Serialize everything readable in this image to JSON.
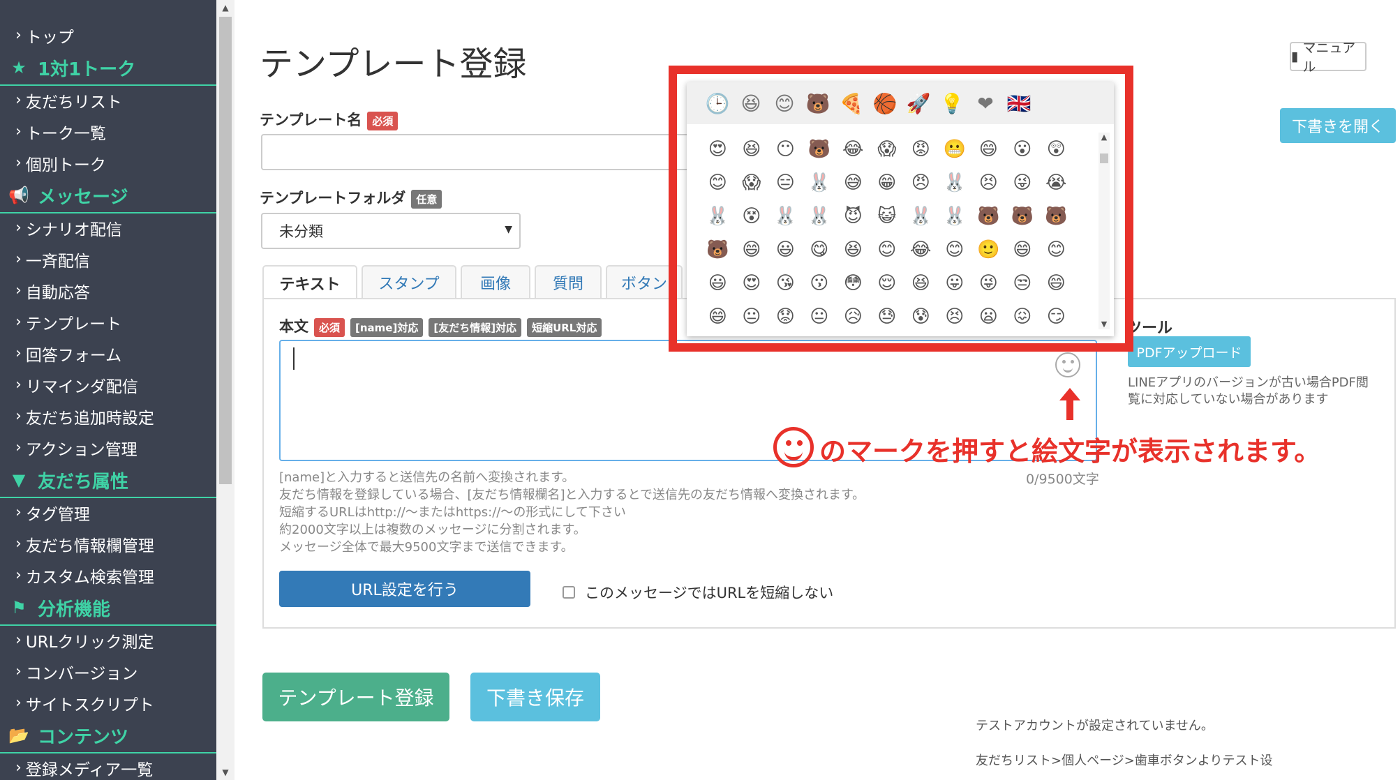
{
  "sidebar": {
    "items": [
      {
        "type": "item",
        "label": "トップ"
      },
      {
        "type": "head",
        "icon": "star-icon",
        "glyph": "★",
        "label": "1対1トーク"
      },
      {
        "type": "item",
        "label": "友だちリスト"
      },
      {
        "type": "item",
        "label": "トーク一覧"
      },
      {
        "type": "item",
        "label": "個別トーク"
      },
      {
        "type": "head",
        "icon": "megaphone-icon",
        "glyph": "📢",
        "label": "メッセージ"
      },
      {
        "type": "item",
        "label": "シナリオ配信"
      },
      {
        "type": "item",
        "label": "一斉配信"
      },
      {
        "type": "item",
        "label": "自動応答"
      },
      {
        "type": "item",
        "label": "テンプレート"
      },
      {
        "type": "item",
        "label": "回答フォーム"
      },
      {
        "type": "item",
        "label": "リマインダ配信"
      },
      {
        "type": "item",
        "label": "友だち追加時設定"
      },
      {
        "type": "item",
        "label": "アクション管理"
      },
      {
        "type": "head",
        "icon": "filter-icon",
        "glyph": "▼",
        "label": "友だち属性"
      },
      {
        "type": "item",
        "label": "タグ管理"
      },
      {
        "type": "item",
        "label": "友だち情報欄管理"
      },
      {
        "type": "item",
        "label": "カスタム検索管理"
      },
      {
        "type": "head",
        "icon": "flag-icon",
        "glyph": "⚑",
        "label": "分析機能"
      },
      {
        "type": "item",
        "label": "URLクリック測定"
      },
      {
        "type": "item",
        "label": "コンバージョン"
      },
      {
        "type": "item",
        "label": "サイトスクリプト"
      },
      {
        "type": "head",
        "icon": "folder-icon",
        "glyph": "📂",
        "label": "コンテンツ"
      },
      {
        "type": "item",
        "label": "登録メディア一覧"
      }
    ]
  },
  "header": {
    "title": "テンプレート登録",
    "manual_label": "マニュアル",
    "draft_open_label": "下書きを開く"
  },
  "form": {
    "name_label": "テンプレート名",
    "required_badge": "必須",
    "optional_badge": "任意",
    "folder_label": "テンプレートフォルダ",
    "folder_value": "未分類",
    "tabs": [
      "テキスト",
      "スタンプ",
      "画像",
      "質問",
      "ボタン"
    ],
    "body_label": "本文",
    "body_badges": [
      "[name]対応",
      "[友だち情報]対応",
      "短縮URL対応"
    ],
    "help_lines": [
      "[name]と入力すると送信先の名前へ変換されます。",
      "友だち情報を登録している場合、[友だち情報欄名]と入力するとで送信先の友だち情報へ変換されます。",
      "短縮するURLはhttp://〜またはhttps://〜の形式にして下さい",
      "約2000文字以上は複数のメッセージに分割されます。",
      "メッセージ全体で最大9500文字まで送信できます。"
    ],
    "char_count": "0/9500文字",
    "url_button": "URL設定を行う",
    "shorten_label": "このメッセージではURLを短縮しない"
  },
  "tools": {
    "title": "ツール",
    "pdf_button": "PDFアップロード",
    "note_lines": [
      "LINEアプリのバージョンが古い場合PDF閲",
      "覧に対応していない場合があります"
    ]
  },
  "actions": {
    "register_button": "テンプレート登録",
    "draft_save_button": "下書き保存"
  },
  "test_notes": [
    "テストアカウントが設定されていません。",
    "友だちリスト>個人ページ>歯車ボタンよりテスト设"
  ],
  "emoji_picker": {
    "categories": [
      "🕒",
      "😆",
      "😊",
      "🐻",
      "🍕",
      "🏀",
      "🚀",
      "💡",
      "❤",
      "🇬🇧"
    ],
    "emojis": [
      "😍",
      "😆",
      "😶",
      "🐻",
      "😂",
      "😱",
      "😡",
      "😬",
      "😄",
      "😮",
      "😲",
      "😊",
      "😱",
      "😑",
      "🐰",
      "😅",
      "😁",
      "😠",
      "🐰",
      "😣",
      "😜",
      "😭",
      "🐰",
      "😵",
      "🐰",
      "🐰",
      "😈",
      "😺",
      "🐰",
      "🐰",
      "🐻",
      "🐻",
      "🐻",
      "🐻",
      "😄",
      "😃",
      "😋",
      "😆",
      "😊",
      "😂",
      "😊",
      "🙂",
      "😄",
      "😊",
      "😃",
      "😍",
      "😘",
      "😗",
      "😳",
      "😌",
      "😆",
      "😛",
      "😜",
      "😒",
      "😄",
      "😄",
      "😐",
      "😟",
      "😐",
      "😥",
      "😓",
      "😰",
      "😣",
      "😦",
      "😖",
      "😏"
    ]
  },
  "annotation": {
    "text": "のマークを押すと絵文字が表示されます。",
    "color": "#e8312a"
  },
  "colors": {
    "sidebar_bg": "#3c4250",
    "sidebar_accent": "#3fd3a6",
    "primary": "#337ab7",
    "info": "#5bc0de",
    "success": "#4caf8b",
    "danger": "#d9534f"
  }
}
